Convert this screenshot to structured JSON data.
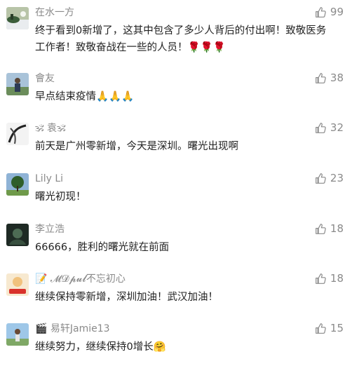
{
  "comments": [
    {
      "name": "在水一方",
      "text": "终于看到0新增了，这其中包含了多少人背后的付出啊！致敬医务工作者！致敬奋战在一些的人员！🌹🌹🌹",
      "likes": "99",
      "avatar": "landscape-avatar"
    },
    {
      "name": "會友",
      "text": "早点结束疫情🙏🙏🙏",
      "likes": "38",
      "avatar": "person-avatar"
    },
    {
      "name": "🕉 袁🕉",
      "text": "前天是广州零新增，今天是深圳。曙光出现啊",
      "likes": "32",
      "avatar": "ink-avatar"
    },
    {
      "name": "Lily Li",
      "text": "曙光初现！",
      "likes": "23",
      "avatar": "tree-avatar"
    },
    {
      "name": "李立浩",
      "text": "66666，胜利的曙光就在前面",
      "likes": "18",
      "avatar": "dark-avatar"
    },
    {
      "name": "📝 𝓜𝓓𝓹𝓾𝓵不忘初心",
      "text": "继续保持零新增，深圳加油！武汉加油！",
      "likes": "18",
      "avatar": "wuhan-avatar"
    },
    {
      "name": "🎬 易轩Jamie13",
      "text": "继续努力，继续保持0增长🤗",
      "likes": "15",
      "avatar": "outdoor-avatar"
    }
  ],
  "colors": {
    "name": "#8a8a8a",
    "text": "#222222",
    "like": "#8a8a8a"
  }
}
